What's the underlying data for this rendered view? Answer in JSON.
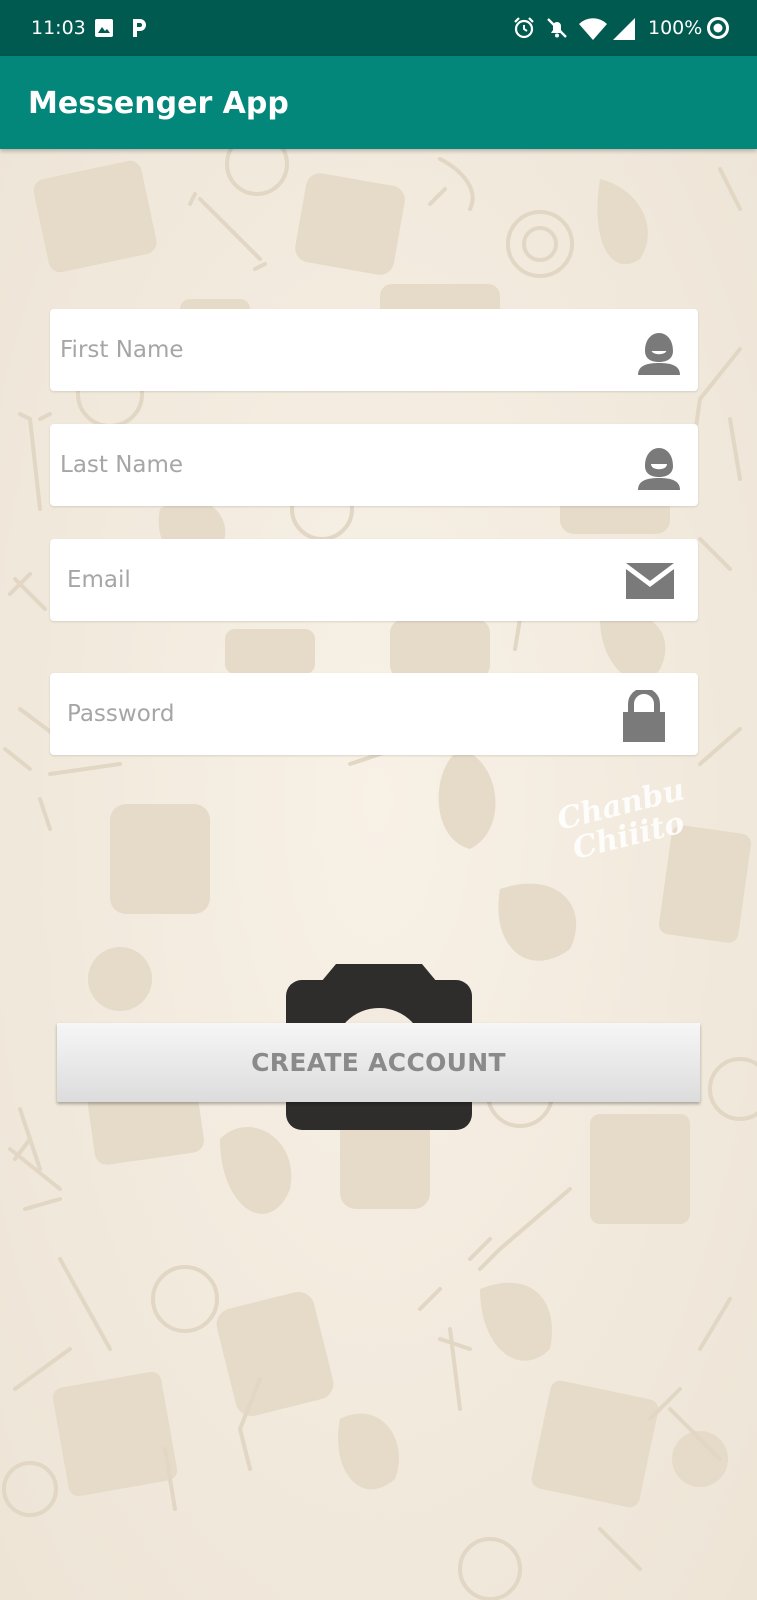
{
  "status_bar": {
    "time": "11:03",
    "left_icons": [
      "image-icon",
      "p-app-icon"
    ],
    "right_icons": [
      "alarm-icon",
      "bell-off-icon",
      "wifi-icon",
      "signal-icon",
      "circle-status-icon"
    ],
    "battery_text": "100%"
  },
  "app_bar": {
    "title": "Messenger App",
    "color": "#02877a",
    "status_color": "#015a4f"
  },
  "form": {
    "first_name": {
      "placeholder": "First Name",
      "value": "",
      "icon": "person-icon"
    },
    "last_name": {
      "placeholder": "Last Name",
      "value": "",
      "icon": "person-icon"
    },
    "email": {
      "placeholder": "Email",
      "value": "",
      "icon": "envelope-icon"
    },
    "password": {
      "placeholder": "Password",
      "value": "",
      "icon": "lock-icon"
    }
  },
  "camera": {
    "icon": "camera-icon"
  },
  "create_account": {
    "label": "CREATE ACCOUNT"
  },
  "watermark": {
    "line1": "Chanbu",
    "line2": "Chiiito"
  }
}
